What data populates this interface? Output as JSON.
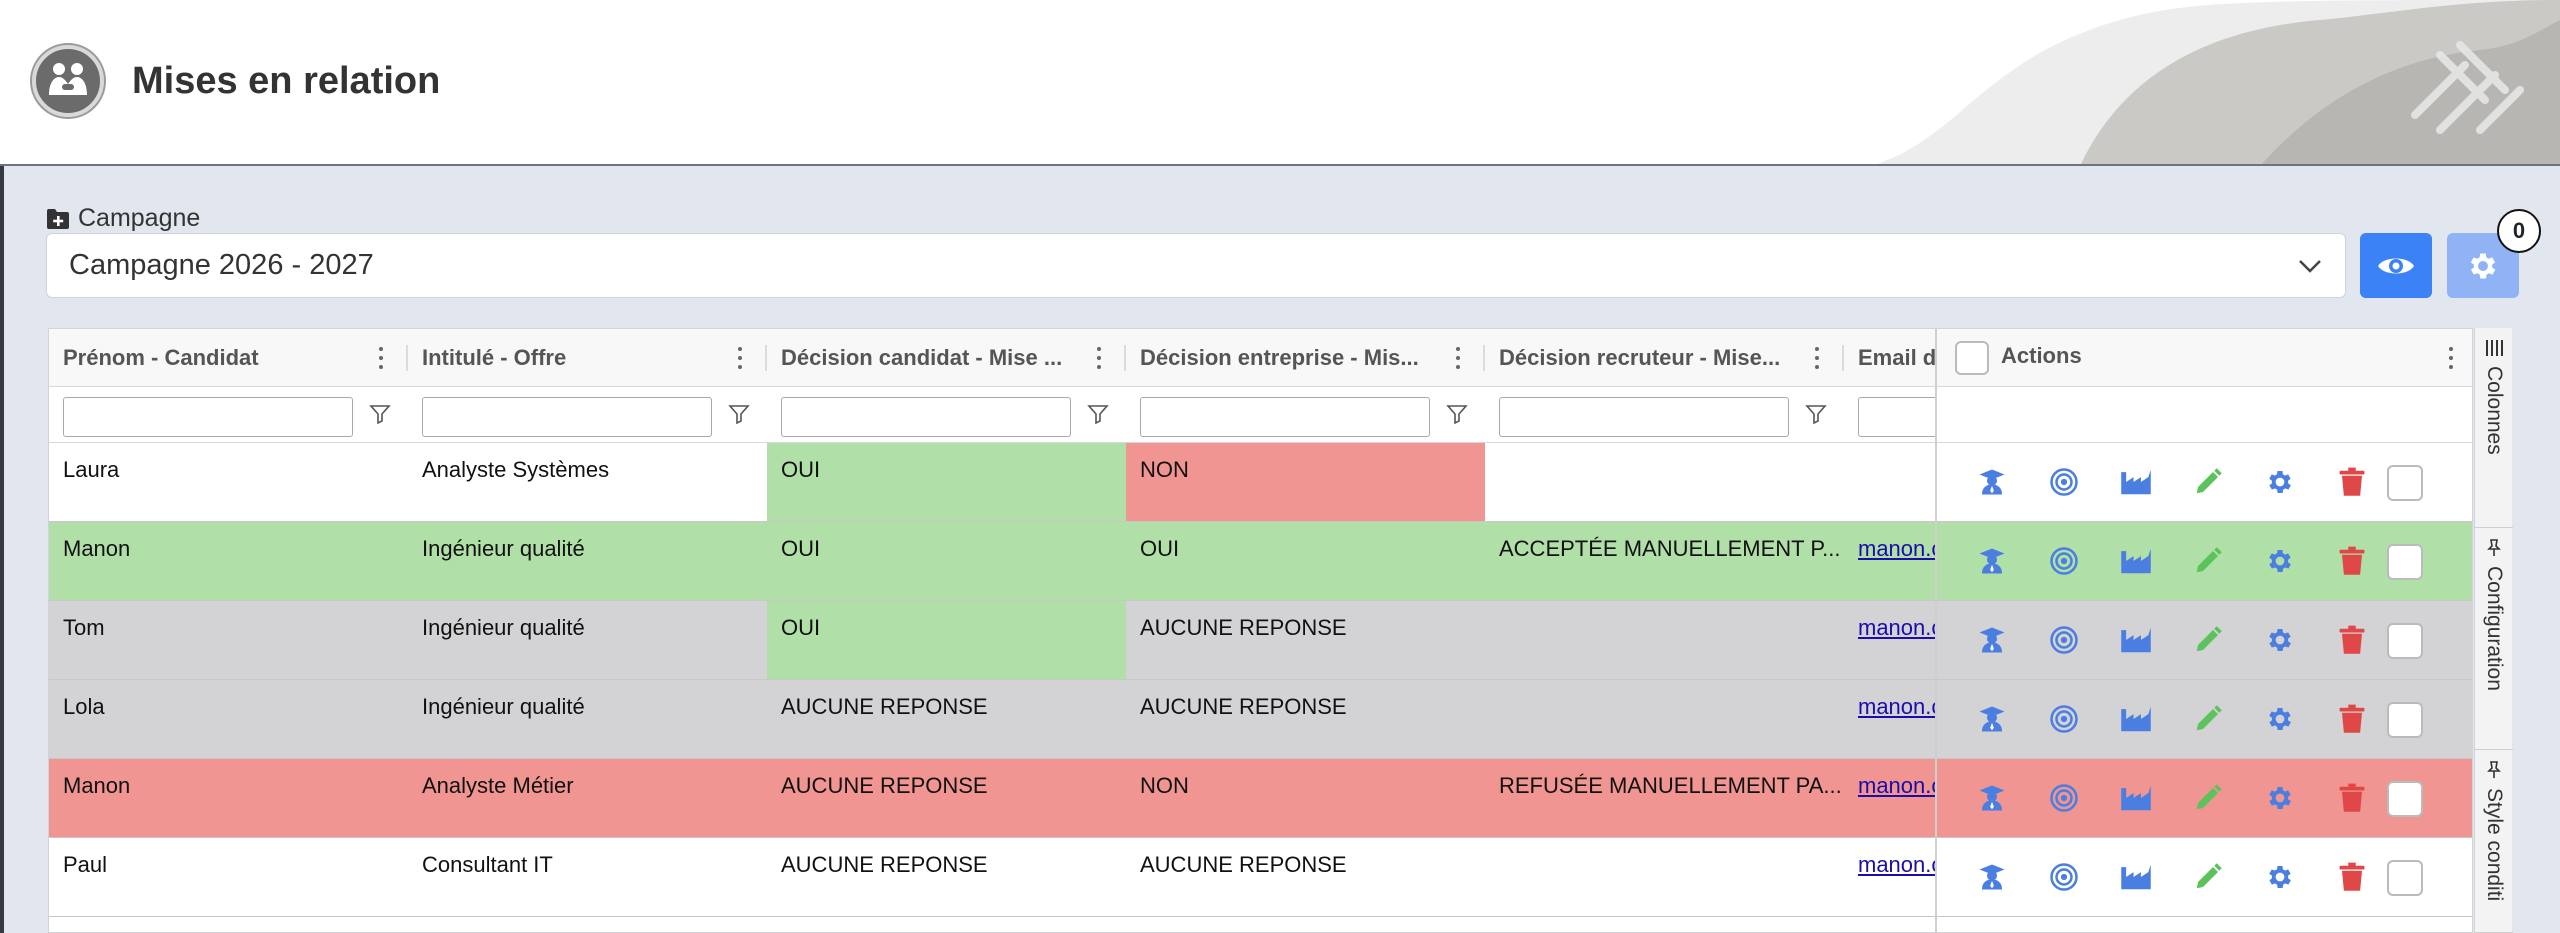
{
  "header": {
    "title": "Mises en relation"
  },
  "campaign": {
    "label": "Campagne",
    "selected": "Campagne 2026 - 2027",
    "badge_count": "0"
  },
  "grid": {
    "columns": [
      "Prénom - Candidat",
      "Intitulé - Offre",
      "Décision candidat - Mise ...",
      "Décision entreprise - Mis...",
      "Décision recruteur - Mise...",
      "Email d"
    ],
    "actions_header": "Actions",
    "rows": [
      {
        "prenom": "Laura",
        "offre": "Analyste Systèmes",
        "dec_candidat": "OUI",
        "dec_entreprise": "NON",
        "dec_recruteur": "",
        "email": ""
      },
      {
        "prenom": "Manon",
        "offre": "Ingénieur qualité",
        "dec_candidat": "OUI",
        "dec_entreprise": "OUI",
        "dec_recruteur": "ACCEPTÉE MANUELLEMENT P...",
        "email": "manon.c"
      },
      {
        "prenom": "Tom",
        "offre": "Ingénieur qualité",
        "dec_candidat": "OUI",
        "dec_entreprise": "AUCUNE REPONSE",
        "dec_recruteur": "",
        "email": "manon.c"
      },
      {
        "prenom": "Lola",
        "offre": "Ingénieur qualité",
        "dec_candidat": "AUCUNE REPONSE",
        "dec_entreprise": "AUCUNE REPONSE",
        "dec_recruteur": "",
        "email": "manon.c"
      },
      {
        "prenom": "Manon",
        "offre": "Analyste Métier",
        "dec_candidat": "AUCUNE REPONSE",
        "dec_entreprise": "NON",
        "dec_recruteur": "REFUSÉE MANUELLEMENT PA...",
        "email": "manon.c"
      },
      {
        "prenom": "Paul",
        "offre": "Consultant IT",
        "dec_candidat": "AUCUNE REPONSE",
        "dec_entreprise": "AUCUNE REPONSE",
        "dec_recruteur": "",
        "email": "manon.c"
      }
    ],
    "row_action_icons": [
      "student-icon",
      "target-icon",
      "factory-icon",
      "pencil-icon",
      "gear-icon",
      "trash-icon"
    ]
  },
  "side_tabs": [
    "Colonnes",
    "Configuration",
    "Style conditi"
  ],
  "colors": {
    "green": "#b1dfa8",
    "red": "#f09591",
    "grey": "#d3d3d5",
    "accent": "#3b82f6",
    "accent_light": "#8fb3f5",
    "icon_blue": "#4a7ee0",
    "icon_green": "#5cc35c",
    "icon_red": "#e04848"
  }
}
